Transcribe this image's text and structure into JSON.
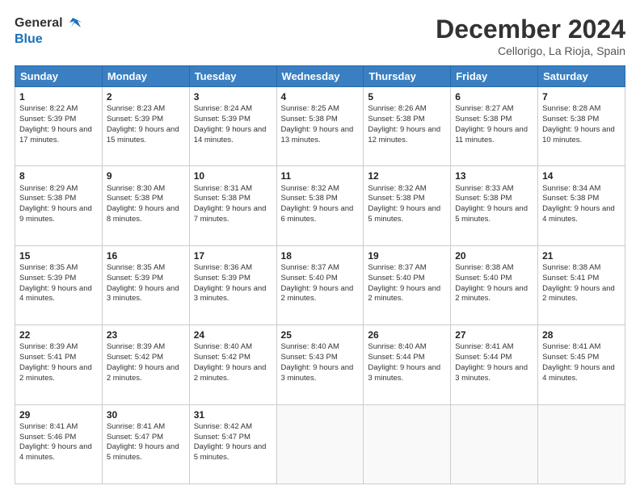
{
  "header": {
    "logo_line1": "General",
    "logo_line2": "Blue",
    "month_title": "December 2024",
    "location": "Cellorigo, La Rioja, Spain"
  },
  "days_of_week": [
    "Sunday",
    "Monday",
    "Tuesday",
    "Wednesday",
    "Thursday",
    "Friday",
    "Saturday"
  ],
  "weeks": [
    [
      {
        "day": 1,
        "sunrise": "8:22 AM",
        "sunset": "5:39 PM",
        "daylight": "9 hours and 17 minutes."
      },
      {
        "day": 2,
        "sunrise": "8:23 AM",
        "sunset": "5:39 PM",
        "daylight": "9 hours and 15 minutes."
      },
      {
        "day": 3,
        "sunrise": "8:24 AM",
        "sunset": "5:39 PM",
        "daylight": "9 hours and 14 minutes."
      },
      {
        "day": 4,
        "sunrise": "8:25 AM",
        "sunset": "5:38 PM",
        "daylight": "9 hours and 13 minutes."
      },
      {
        "day": 5,
        "sunrise": "8:26 AM",
        "sunset": "5:38 PM",
        "daylight": "9 hours and 12 minutes."
      },
      {
        "day": 6,
        "sunrise": "8:27 AM",
        "sunset": "5:38 PM",
        "daylight": "9 hours and 11 minutes."
      },
      {
        "day": 7,
        "sunrise": "8:28 AM",
        "sunset": "5:38 PM",
        "daylight": "9 hours and 10 minutes."
      }
    ],
    [
      {
        "day": 8,
        "sunrise": "8:29 AM",
        "sunset": "5:38 PM",
        "daylight": "9 hours and 9 minutes."
      },
      {
        "day": 9,
        "sunrise": "8:30 AM",
        "sunset": "5:38 PM",
        "daylight": "9 hours and 8 minutes."
      },
      {
        "day": 10,
        "sunrise": "8:31 AM",
        "sunset": "5:38 PM",
        "daylight": "9 hours and 7 minutes."
      },
      {
        "day": 11,
        "sunrise": "8:32 AM",
        "sunset": "5:38 PM",
        "daylight": "9 hours and 6 minutes."
      },
      {
        "day": 12,
        "sunrise": "8:32 AM",
        "sunset": "5:38 PM",
        "daylight": "9 hours and 5 minutes."
      },
      {
        "day": 13,
        "sunrise": "8:33 AM",
        "sunset": "5:38 PM",
        "daylight": "9 hours and 5 minutes."
      },
      {
        "day": 14,
        "sunrise": "8:34 AM",
        "sunset": "5:38 PM",
        "daylight": "9 hours and 4 minutes."
      }
    ],
    [
      {
        "day": 15,
        "sunrise": "8:35 AM",
        "sunset": "5:39 PM",
        "daylight": "9 hours and 4 minutes."
      },
      {
        "day": 16,
        "sunrise": "8:35 AM",
        "sunset": "5:39 PM",
        "daylight": "9 hours and 3 minutes."
      },
      {
        "day": 17,
        "sunrise": "8:36 AM",
        "sunset": "5:39 PM",
        "daylight": "9 hours and 3 minutes."
      },
      {
        "day": 18,
        "sunrise": "8:37 AM",
        "sunset": "5:40 PM",
        "daylight": "9 hours and 2 minutes."
      },
      {
        "day": 19,
        "sunrise": "8:37 AM",
        "sunset": "5:40 PM",
        "daylight": "9 hours and 2 minutes."
      },
      {
        "day": 20,
        "sunrise": "8:38 AM",
        "sunset": "5:40 PM",
        "daylight": "9 hours and 2 minutes."
      },
      {
        "day": 21,
        "sunrise": "8:38 AM",
        "sunset": "5:41 PM",
        "daylight": "9 hours and 2 minutes."
      }
    ],
    [
      {
        "day": 22,
        "sunrise": "8:39 AM",
        "sunset": "5:41 PM",
        "daylight": "9 hours and 2 minutes."
      },
      {
        "day": 23,
        "sunrise": "8:39 AM",
        "sunset": "5:42 PM",
        "daylight": "9 hours and 2 minutes."
      },
      {
        "day": 24,
        "sunrise": "8:40 AM",
        "sunset": "5:42 PM",
        "daylight": "9 hours and 2 minutes."
      },
      {
        "day": 25,
        "sunrise": "8:40 AM",
        "sunset": "5:43 PM",
        "daylight": "9 hours and 3 minutes."
      },
      {
        "day": 26,
        "sunrise": "8:40 AM",
        "sunset": "5:44 PM",
        "daylight": "9 hours and 3 minutes."
      },
      {
        "day": 27,
        "sunrise": "8:41 AM",
        "sunset": "5:44 PM",
        "daylight": "9 hours and 3 minutes."
      },
      {
        "day": 28,
        "sunrise": "8:41 AM",
        "sunset": "5:45 PM",
        "daylight": "9 hours and 4 minutes."
      }
    ],
    [
      {
        "day": 29,
        "sunrise": "8:41 AM",
        "sunset": "5:46 PM",
        "daylight": "9 hours and 4 minutes."
      },
      {
        "day": 30,
        "sunrise": "8:41 AM",
        "sunset": "5:47 PM",
        "daylight": "9 hours and 5 minutes."
      },
      {
        "day": 31,
        "sunrise": "8:42 AM",
        "sunset": "5:47 PM",
        "daylight": "9 hours and 5 minutes."
      },
      null,
      null,
      null,
      null
    ]
  ],
  "labels": {
    "sunrise": "Sunrise:",
    "sunset": "Sunset:",
    "daylight": "Daylight:"
  }
}
